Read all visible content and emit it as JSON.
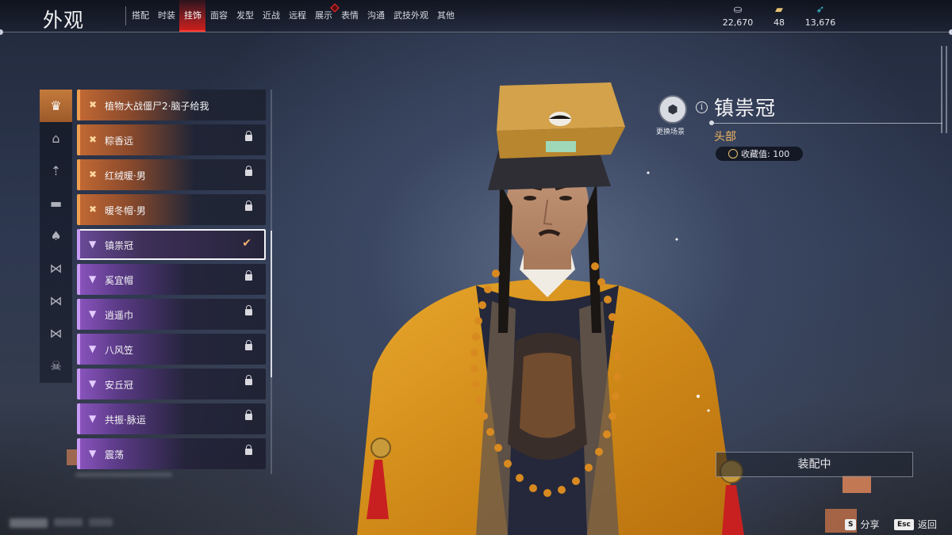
{
  "header": {
    "title": "外观",
    "tabs": [
      {
        "label": "搭配",
        "active": false
      },
      {
        "label": "时装",
        "active": false
      },
      {
        "label": "挂饰",
        "active": true
      },
      {
        "label": "面容",
        "active": false
      },
      {
        "label": "发型",
        "active": false
      },
      {
        "label": "近战",
        "active": false
      },
      {
        "label": "远程",
        "active": false
      },
      {
        "label": "展示",
        "active": false,
        "badge": true
      },
      {
        "label": "表情",
        "active": false
      },
      {
        "label": "沟通",
        "active": false
      },
      {
        "label": "武技外观",
        "active": false
      },
      {
        "label": "其他",
        "active": false
      }
    ],
    "currencies": [
      {
        "icon": "coins-icon",
        "value": "22,670",
        "color": "#c8ccd8"
      },
      {
        "icon": "gold-ingot-icon",
        "value": "48",
        "color": "#e8c070"
      },
      {
        "icon": "feather-icon",
        "value": "13,676",
        "color": "#40c8d8"
      }
    ]
  },
  "categories": [
    {
      "icon": "head-ornament-icon",
      "glyph": "♛",
      "active": true
    },
    {
      "icon": "hat-icon",
      "glyph": "⌂",
      "active": false
    },
    {
      "icon": "hairpin-icon",
      "glyph": "⇡",
      "active": false
    },
    {
      "icon": "face-mask-icon",
      "glyph": "▬",
      "active": false
    },
    {
      "icon": "back-ornament-icon",
      "glyph": "♠",
      "active": false
    },
    {
      "icon": "waist-ornament-icon",
      "glyph": "⋈",
      "active": false
    },
    {
      "icon": "wrist-ornament-icon",
      "glyph": "⋈",
      "active": false
    },
    {
      "icon": "leg-ornament-icon",
      "glyph": "⋈",
      "active": false
    },
    {
      "icon": "demon-mask-icon",
      "glyph": "☠",
      "active": false
    }
  ],
  "items": [
    {
      "label": "植物大战僵尸2·脑子给我",
      "rarity": "orange",
      "locked": false,
      "selected": false
    },
    {
      "label": "粽香远",
      "rarity": "orange",
      "locked": true,
      "selected": false
    },
    {
      "label": "红绒暖·男",
      "rarity": "orange",
      "locked": true,
      "selected": false
    },
    {
      "label": "暖冬帽·男",
      "rarity": "orange",
      "locked": true,
      "selected": false
    },
    {
      "label": "镇祟冠",
      "rarity": "purple",
      "locked": false,
      "selected": true
    },
    {
      "label": "奚宜帽",
      "rarity": "purple",
      "locked": true,
      "selected": false
    },
    {
      "label": "逍遥巾",
      "rarity": "purple",
      "locked": true,
      "selected": false
    },
    {
      "label": "八风笠",
      "rarity": "purple",
      "locked": true,
      "selected": false
    },
    {
      "label": "安丘冠",
      "rarity": "purple",
      "locked": true,
      "selected": false
    },
    {
      "label": "共振·脉运",
      "rarity": "purple",
      "locked": true,
      "selected": false
    },
    {
      "label": "震荡",
      "rarity": "purple",
      "locked": true,
      "selected": false
    }
  ],
  "detail": {
    "scene_button": "更换场景",
    "name": "镇祟冠",
    "slot": "头部",
    "collection_label": "收藏值: 100",
    "equip_button": "装配中"
  },
  "hints": {
    "share_key": "S",
    "share_label": "分享",
    "back_key": "Esc",
    "back_label": "返回"
  },
  "colors": {
    "accent_red": "#ff3a2a",
    "orange_rarity": "#f0a050",
    "purple_rarity": "#c89cf5",
    "slot_gold": "#f0b860"
  }
}
